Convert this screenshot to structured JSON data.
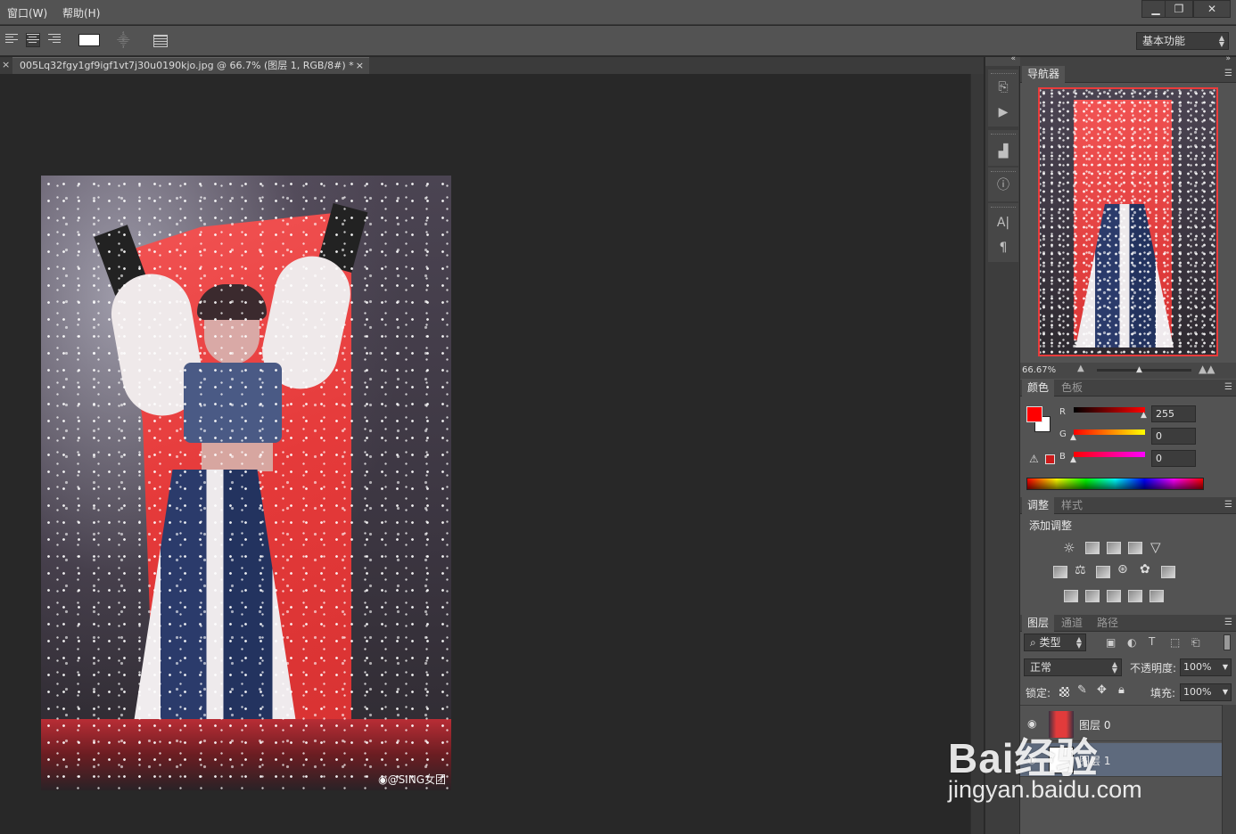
{
  "menu": {
    "items": [
      "窗口(W)",
      "帮助(H)"
    ]
  },
  "window_controls": {
    "minimize": "▁",
    "restore": "❐",
    "close": "✕"
  },
  "options": {
    "workspace": "基本功能"
  },
  "document": {
    "tab_title": "005Lq32fgy1gf9igf1vt7j30u0190kjo.jpg @ 66.7% (图层 1, RGB/8#) *",
    "close_symbol": "×",
    "watermark": "@SING女团"
  },
  "navigator": {
    "tab": "导航器",
    "zoom": "66.67%"
  },
  "color_panel": {
    "tabs": [
      "颜色",
      "色板"
    ],
    "channels": [
      {
        "name": "R",
        "value": "255"
      },
      {
        "name": "G",
        "value": "0"
      },
      {
        "name": "B",
        "value": "0"
      }
    ],
    "foreground": "#ff0000",
    "background": "#ffffff"
  },
  "adjust_panel": {
    "tabs": [
      "调整",
      "样式"
    ],
    "title": "添加调整"
  },
  "layers_panel": {
    "tabs": [
      "图层",
      "通道",
      "路径"
    ],
    "filter_kind": "类型",
    "blend_mode": "正常",
    "opacity_label": "不透明度:",
    "opacity": "100%",
    "lock_label": "锁定:",
    "fill_label": "填充:",
    "fill": "100%",
    "layers": [
      {
        "name": "图层 0",
        "selected": false
      },
      {
        "name": "图层 1",
        "selected": true
      }
    ]
  },
  "overlay": {
    "brand": "Bai经验",
    "url": "jingyan.baidu.com"
  },
  "icons": {
    "strip": [
      "history-icon",
      "play-icon",
      "histogram-icon",
      "info-icon",
      "character-icon",
      "paragraph-icon"
    ]
  }
}
